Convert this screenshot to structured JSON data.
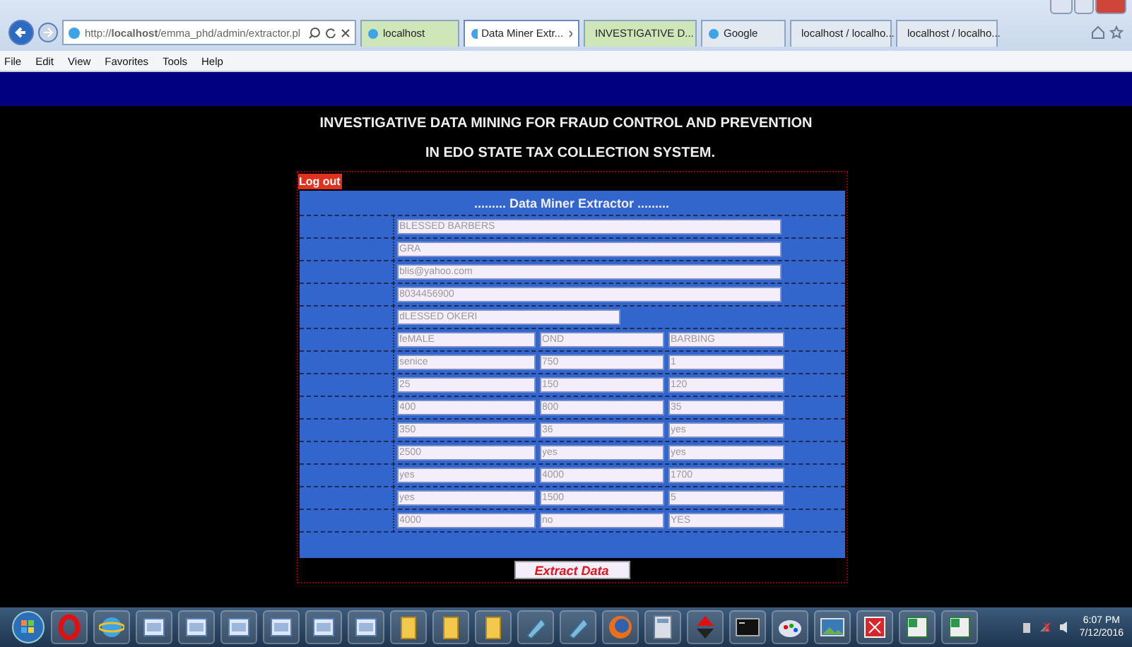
{
  "browser": {
    "address": "http://**localhost**/emma_phd/admin/extractor.pl",
    "tabs": [
      {
        "label": "localhost",
        "selected": false,
        "color": "#cfe6b8"
      },
      {
        "label": "Data Miner Extr...",
        "selected": true,
        "color": "#ffffff"
      },
      {
        "label": "INVESTIGATIVE D...",
        "selected": false,
        "color": "#cfe6b8"
      },
      {
        "label": "Google",
        "selected": false,
        "color": "#e3e9f1"
      },
      {
        "label": "localhost / localho...",
        "selected": false,
        "color": "#e3e9f1"
      },
      {
        "label": "localhost / localho...",
        "selected": false,
        "color": "#e3e9f1"
      }
    ],
    "menu": [
      "File",
      "Edit",
      "View",
      "Favorites",
      "Tools",
      "Help"
    ]
  },
  "page": {
    "title_lines": [
      "INVESTIGATIVE DATA MINING FOR FRAUD CONTROL AND PREVENTION",
      "IN EDO STATE TAX COLLECTION SYSTEM."
    ],
    "logout": "Log out",
    "form_title": "......... Data Miner Extractor .........",
    "rows": [
      {
        "kind": "wide",
        "values": [
          "BLESSED BARBERS"
        ]
      },
      {
        "kind": "wide",
        "values": [
          "GRA"
        ]
      },
      {
        "kind": "wide",
        "values": [
          "blis@yahoo.com"
        ]
      },
      {
        "kind": "wide",
        "values": [
          "8034456900"
        ]
      },
      {
        "kind": "medium",
        "values": [
          "dLESSED OKERI"
        ]
      },
      {
        "kind": "triple",
        "values": [
          "feMALE",
          "OND",
          "BARBING"
        ]
      },
      {
        "kind": "triple",
        "values": [
          "senice",
          "750",
          "1"
        ]
      },
      {
        "kind": "triple",
        "values": [
          "25",
          "150",
          "120"
        ]
      },
      {
        "kind": "triple",
        "values": [
          "400",
          "800",
          "35"
        ]
      },
      {
        "kind": "triple",
        "values": [
          "350",
          "36",
          "yes"
        ]
      },
      {
        "kind": "triple",
        "values": [
          "2500",
          "yes",
          "yes"
        ]
      },
      {
        "kind": "triple",
        "values": [
          "yes",
          "4000",
          "1700"
        ]
      },
      {
        "kind": "triple",
        "values": [
          "yes",
          "1500",
          "5"
        ]
      },
      {
        "kind": "triple",
        "values": [
          "4000",
          "no",
          "YES"
        ]
      }
    ],
    "button": "Extract Data"
  },
  "taskbar": {
    "time": "6:07 PM",
    "date": "7/12/2016"
  }
}
